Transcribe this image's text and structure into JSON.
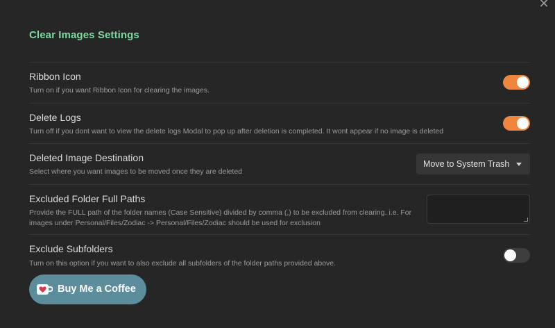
{
  "modal": {
    "close_symbol": "✕",
    "title": "Clear Images Settings"
  },
  "settings": [
    {
      "name": "Ribbon Icon",
      "description": "Turn on if you want Ribbon Icon for clearing the images.",
      "control": "toggle",
      "value": true
    },
    {
      "name": "Delete Logs",
      "description": "Turn off if you dont want to view the delete logs Modal to pop up after deletion is completed. It wont appear if no image is deleted",
      "control": "toggle",
      "value": true
    },
    {
      "name": "Deleted Image Destination",
      "description": "Select where you want images to be moved once they are deleted",
      "control": "dropdown",
      "value": "Move to System Trash"
    },
    {
      "name": "Excluded Folder Full Paths",
      "description_line1": "Provide the FULL path of the folder names (Case Sensitive) divided by comma (,) to be excluded from clearing. i.e. For",
      "description_line2": "images under Personal/Files/Zodiac -> Personal/Files/Zodiac should be used for exclusion",
      "control": "textarea",
      "value": ""
    },
    {
      "name": "Exclude Subfolders",
      "description": "Turn on this option if you want to also exclude all subfolders of the folder paths provided above.",
      "control": "toggle",
      "value": false
    }
  ],
  "coffee_button": {
    "label": "Buy Me a Coffee",
    "icon": "coffee-cup-heart-icon"
  },
  "colors": {
    "title": "#7fd8a0",
    "toggle_on": "#f0863d",
    "toggle_off": "#3e3e3e",
    "coffee_button": "#5b8d9c",
    "background": "#262626"
  }
}
